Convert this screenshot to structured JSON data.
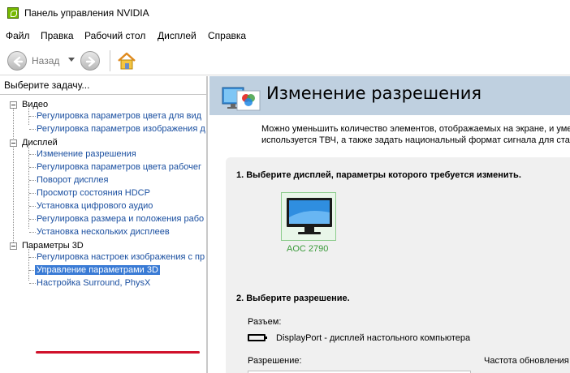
{
  "window": {
    "title": "Панель управления NVIDIA"
  },
  "menu": [
    "Файл",
    "Правка",
    "Рабочий стол",
    "Дисплей",
    "Справка"
  ],
  "toolbar": {
    "back_label": "Назад"
  },
  "left_panel": {
    "task_label": "Выберите задачу...",
    "categories": [
      {
        "label": "Видео",
        "items": [
          "Регулировка параметров цвета для вид",
          "Регулировка параметров изображения д"
        ]
      },
      {
        "label": "Дисплей",
        "items": [
          "Изменение разрешения",
          "Регулировка параметров цвета рабочег",
          "Поворот дисплея",
          "Просмотр состояния HDCP",
          "Установка цифрового аудио",
          "Регулировка размера и положения рабо",
          "Установка нескольких дисплеев"
        ]
      },
      {
        "label": "Параметры 3D",
        "items": [
          "Регулировка настроек изображения с пр",
          "Управление параметрами 3D",
          "Настройка Surround, PhysX"
        ]
      }
    ],
    "selected_item": "Управление параметрами 3D"
  },
  "right_panel": {
    "title": "Изменение разрешения",
    "description_line1": "Можно уменьшить количество элементов, отображаемых на экране, и уме",
    "description_line2": "используется ТВЧ, а также задать национальный формат сигнала для ста",
    "step1": "1. Выберите дисплей, параметры которого требуется изменить.",
    "monitor_name": "AOC 2790",
    "step2": "2. Выберите разрешение.",
    "connector_label": "Разъем:",
    "connector_value": "DisplayPort - дисплей настольного компьютера",
    "resolution_label": "Разрешение:",
    "refresh_label": "Частота обновления"
  },
  "colors": {
    "header_band": "#bfd0e0",
    "link": "#1a4fa0",
    "selection": "#3a7bd5",
    "annotation_red": "#d0112b",
    "monitor_label": "#3a9a3a"
  }
}
